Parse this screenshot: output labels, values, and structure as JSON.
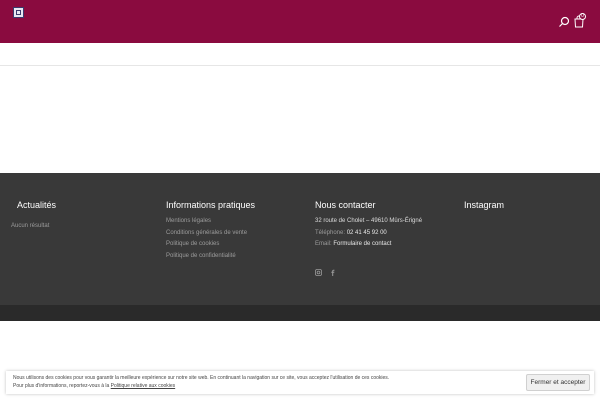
{
  "header": {
    "logo_icon": "logo-icon",
    "search_icon": "search-icon",
    "cart_icon": "cart-icon",
    "cart_count": "0",
    "brand_color": "#8a0b3f"
  },
  "footer": {
    "background": "#393939",
    "news": {
      "title": "Actualités",
      "empty_text": "Aucun résultat"
    },
    "info": {
      "title": "Informations pratiques",
      "links": [
        "Mentions légales",
        "Conditions générales de vente",
        "Politique de cookies",
        "Politique de confidentialité"
      ]
    },
    "contact": {
      "title": "Nous contacter",
      "address": "32 route de Cholet – 49610 Mûrs-Érigné",
      "phone_label": "Téléphone:",
      "phone_value": "02 41 45 92 00",
      "email_label": "Email:",
      "email_value": "Formulaire de contact",
      "social": [
        "instagram-icon",
        "facebook-icon"
      ]
    },
    "instagram": {
      "title": "Instagram"
    }
  },
  "cookie": {
    "line1": "Nous utilisons des cookies pour vous garantir la meilleure expérience sur notre site web. En continuant la navigation sur ce site, vous acceptez l'utilisation de ces cookies.",
    "line2_prefix": "Pour plus d'informations, reportez-vous à la",
    "link": "Politique relative aux cookies",
    "button": "Fermer et accepter"
  }
}
